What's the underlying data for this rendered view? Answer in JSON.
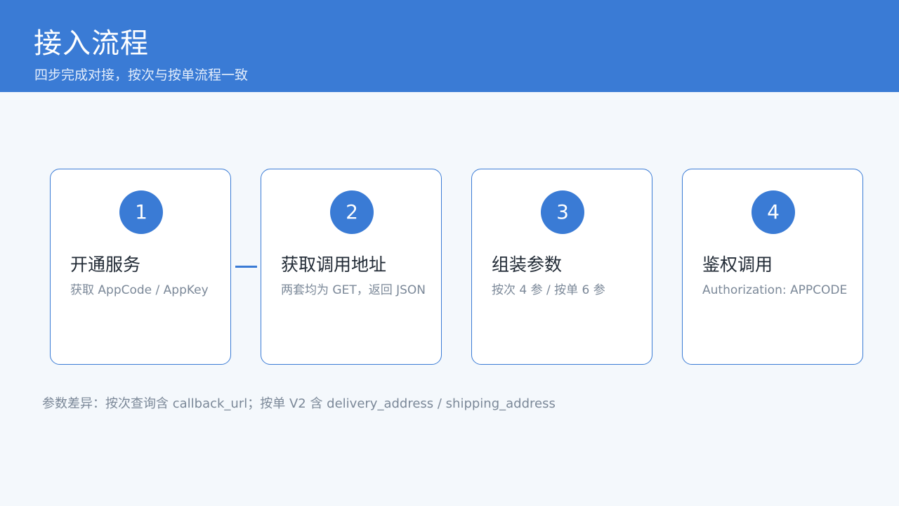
{
  "header": {
    "title": "接入流程",
    "subtitle": "四步完成对接，按次与按单流程一致"
  },
  "steps": [
    {
      "number": "1",
      "title": "开通服务",
      "desc": "获取 AppCode / AppKey"
    },
    {
      "number": "2",
      "title": "获取调用地址",
      "desc": "两套均为 GET，返回 JSON"
    },
    {
      "number": "3",
      "title": "组装参数",
      "desc": "按次 4 参 / 按单 6 参"
    },
    {
      "number": "4",
      "title": "鉴权调用",
      "desc": "Authorization: APPCODE"
    }
  ],
  "note": "参数差异：按次查询含 callback_url；按单 V2 含 delivery_address / shipping_address",
  "colors": {
    "accent": "#3a7bd5",
    "background": "#f4f8fc",
    "text_primary": "#222b36",
    "text_secondary": "#7b8898"
  }
}
